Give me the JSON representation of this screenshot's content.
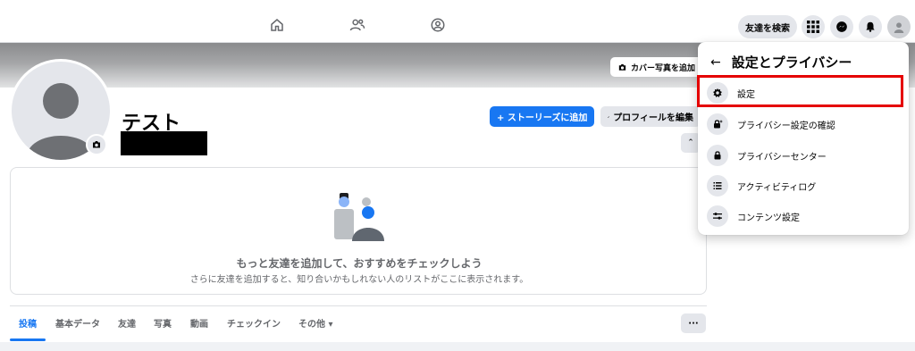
{
  "topbar": {
    "search_friends_label": "友達を検索",
    "nav_icons": [
      "home-icon",
      "friends-icon",
      "groups-icon"
    ],
    "right_icons": [
      "menu-grid-icon",
      "messenger-icon",
      "bell-icon",
      "account-avatar-icon"
    ]
  },
  "cover": {
    "add_cover_label": "カバー写真を追加"
  },
  "profile": {
    "name": "テスト",
    "add_story_label": "+ ストーリーズに追加",
    "edit_profile_label": "プロフィールを編集"
  },
  "suggest": {
    "title": "もっと友達を追加して、おすすめをチェックしよう",
    "subtitle": "さらに友達を追加すると、知り合いかもしれない人のリストがここに表示されます。"
  },
  "tabs": [
    {
      "label": "投稿",
      "active": true
    },
    {
      "label": "基本データ",
      "active": false
    },
    {
      "label": "友達",
      "active": false
    },
    {
      "label": "写真",
      "active": false
    },
    {
      "label": "動画",
      "active": false
    },
    {
      "label": "チェックイン",
      "active": false
    },
    {
      "label": "その他 ▾",
      "active": false
    }
  ],
  "tabs_more_label": "···",
  "menu": {
    "title": "設定とプライバシー",
    "items": [
      {
        "label": "設定",
        "icon": "gear-icon",
        "highlighted": true
      },
      {
        "label": "プライバシー設定の確認",
        "icon": "lock-sparkle-icon"
      },
      {
        "label": "プライバシーセンター",
        "icon": "lock-icon"
      },
      {
        "label": "アクティビティログ",
        "icon": "list-icon"
      },
      {
        "label": "コンテンツ設定",
        "icon": "sliders-icon"
      }
    ]
  },
  "colors": {
    "accent": "#1877f2",
    "highlight_border": "#e50000"
  }
}
